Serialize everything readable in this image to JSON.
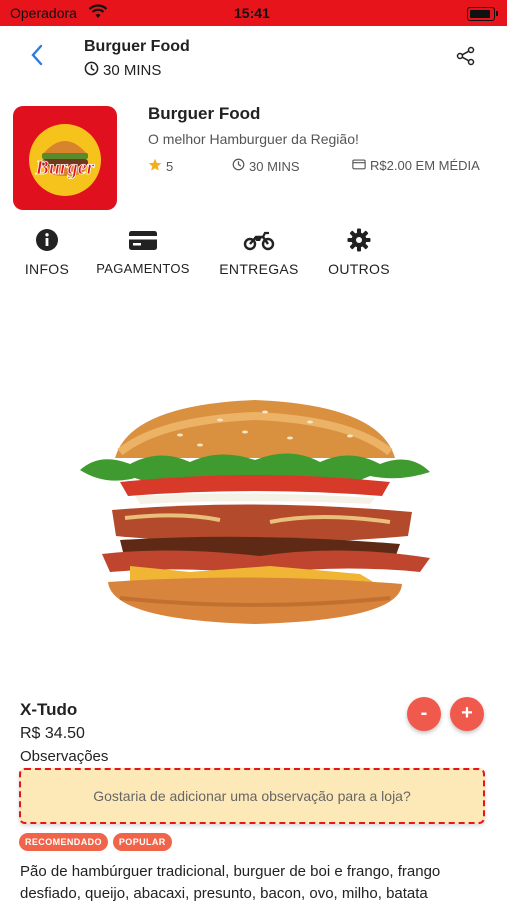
{
  "status": {
    "carrier": "Operadora",
    "time": "15:41"
  },
  "header": {
    "title": "Burguer Food",
    "time": "30 MINS"
  },
  "store": {
    "logo_text": "Burger",
    "name": "Burguer Food",
    "description": "O melhor Hamburguer da Região!",
    "rating": "5",
    "time": "30 MINS",
    "avg_price": "R$2.00 EM MÉDIA"
  },
  "tabs": [
    {
      "label": "INFOS",
      "icon": "info-icon"
    },
    {
      "label": "PAGAMENTOS",
      "icon": "card-icon"
    },
    {
      "label": "ENTREGAS",
      "icon": "motorcycle-icon"
    },
    {
      "label": "OUTROS",
      "icon": "gear-icon"
    }
  ],
  "product": {
    "name": "X-Tudo",
    "price": "R$ 34.50",
    "observations_label": "Observações",
    "observation_placeholder": "Gostaria de adicionar uma observação para a loja?",
    "minus_label": "-",
    "plus_label": "+",
    "badges": [
      "RECOMENDADO",
      "POPULAR"
    ],
    "description": "Pão de hambúrguer tradicional, burguer de boi e frango, frango desfiado, queijo, abacaxi, presunto, bacon, ovo, milho, batata"
  },
  "colors": {
    "brand_red": "#e8141c",
    "accent_orange": "#f05a4d",
    "link_blue": "#2a7be4",
    "note_bg": "#fde9b8"
  }
}
